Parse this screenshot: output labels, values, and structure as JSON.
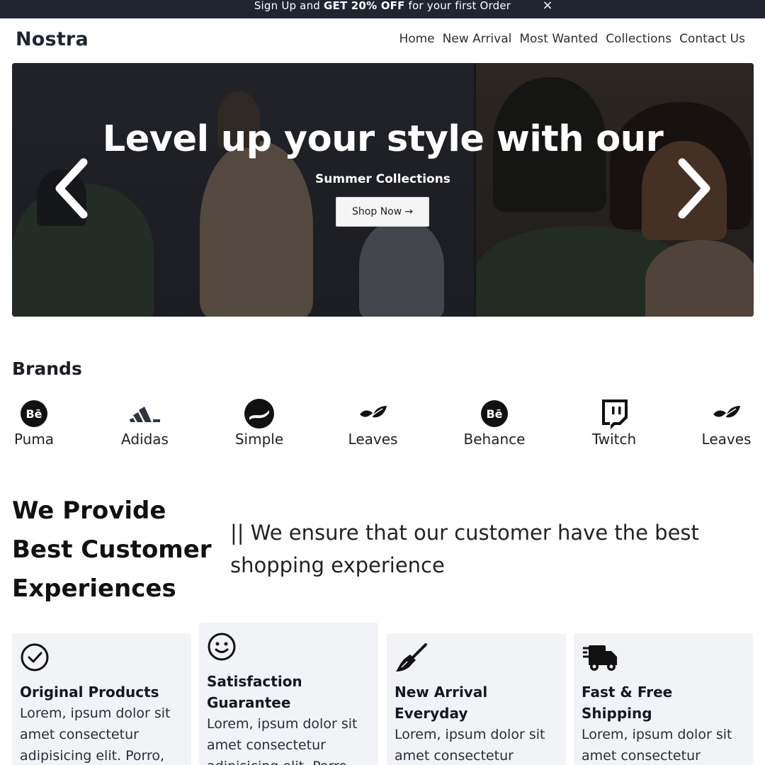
{
  "promo": {
    "text_before": "Sign Up and ",
    "text_bold": "GET 20% OFF",
    "text_after": " for your first Order",
    "close_label": "×"
  },
  "header": {
    "logo": "Nostra",
    "nav": [
      "Home",
      "New Arrival",
      "Most Wanted",
      "Collections",
      "Contact Us"
    ]
  },
  "hero": {
    "title": "Level up your style with our",
    "subtitle": "Summer Collections",
    "button_label": "Shop Now",
    "button_arrow": "→"
  },
  "brands": {
    "title": "Brands",
    "items": [
      {
        "label": "Puma",
        "icon": "behance-icon"
      },
      {
        "label": "Adidas",
        "icon": "adidas-icon"
      },
      {
        "label": "Simple",
        "icon": "simple-icon"
      },
      {
        "label": "Leaves",
        "icon": "leaves-icon"
      },
      {
        "label": "Behance",
        "icon": "behance-icon"
      },
      {
        "label": "Twitch",
        "icon": "twitch-icon"
      },
      {
        "label": "Leaves",
        "icon": "leaves-icon"
      }
    ]
  },
  "provide": {
    "title": "We Provide Best Customer Experiences",
    "text": "|| We ensure that our customer have the best shopping experience"
  },
  "features": [
    {
      "title": "Original Products",
      "text": "Lorem, ipsum dolor sit amet consectetur adipisicing elit. Porro,",
      "icon": "check-circle-icon"
    },
    {
      "title": "Satisfaction Guarantee",
      "text": "Lorem, ipsum dolor sit amet consectetur adipisicing elit. Porro,",
      "icon": "smile-icon"
    },
    {
      "title": "New Arrival Everyday",
      "text": "Lorem, ipsum dolor sit amet consectetur adipisicing elit. Porro,",
      "icon": "broom-icon"
    },
    {
      "title": "Fast & Free Shipping",
      "text": "Lorem, ipsum dolor sit amet consectetur adipisicing elit. Porro,",
      "icon": "truck-icon"
    }
  ]
}
